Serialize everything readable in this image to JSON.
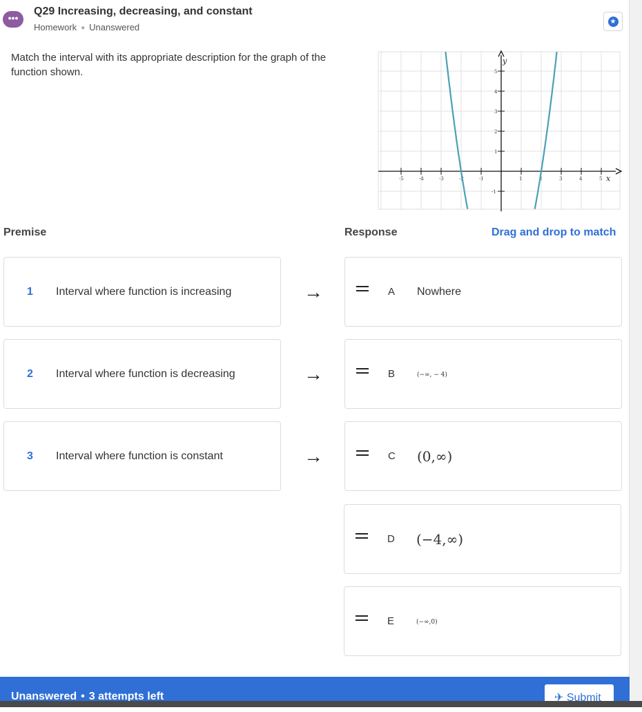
{
  "header": {
    "icon": "chat-icon",
    "title": "Q29 Increasing, decreasing, and constant",
    "category": "Homework",
    "status": "Unanswered"
  },
  "prompt": "Match the interval with its appropriate description for the graph of the function shown.",
  "graph": {
    "x_label": "x",
    "y_label": "y",
    "x_ticks": [
      "-5",
      "-4",
      "-3",
      "-2",
      "-1",
      "1",
      "2",
      "3",
      "4",
      "5"
    ],
    "y_ticks": [
      "5",
      "4",
      "3",
      "2",
      "1",
      "-1"
    ],
    "curve_color": "#4aa0b5",
    "x_range": [
      -6,
      6
    ],
    "y_range": [
      -1.8,
      6
    ]
  },
  "labels": {
    "premise": "Premise",
    "response": "Response",
    "drag_hint": "Drag and drop to match"
  },
  "premises": [
    {
      "num": "1",
      "text": "Interval where function is increasing"
    },
    {
      "num": "2",
      "text": "Interval where function is decreasing"
    },
    {
      "num": "3",
      "text": "Interval where function is constant"
    }
  ],
  "arrow": "→",
  "responses": [
    {
      "letter": "A",
      "text": "Nowhere"
    },
    {
      "letter": "B",
      "text": "(−∞, − 4)"
    },
    {
      "letter": "C",
      "text": "(0,∞)"
    },
    {
      "letter": "D",
      "text": "(−4,∞)"
    },
    {
      "letter": "E",
      "text": "(−∞,0)"
    }
  ],
  "footer": {
    "status": "Unanswered",
    "attempts": "3 attempts left",
    "submit_label": "Submit"
  },
  "colors": {
    "accent": "#2f6fd6",
    "icon_bg": "#8e5aa0"
  }
}
